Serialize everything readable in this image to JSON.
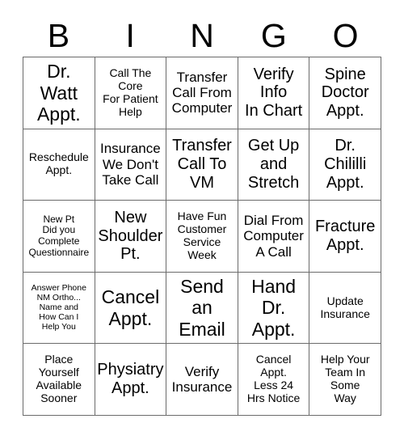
{
  "card": {
    "header_letters": [
      "B",
      "I",
      "N",
      "G",
      "O"
    ],
    "accent_color": "#000000",
    "border_color": "#6b6b6b",
    "cell_background": "#ffffff"
  },
  "grid": {
    "columns": 5,
    "rows": 5,
    "cells": [
      {
        "text": "Dr.\nWatt\nAppt.",
        "size": "fs-xl"
      },
      {
        "text": "Call The\nCore\nFor Patient\nHelp",
        "size": "fs-sm"
      },
      {
        "text": "Transfer\nCall From\nComputer",
        "size": "fs-md"
      },
      {
        "text": "Verify\nInfo\nIn Chart",
        "size": "fs-lg"
      },
      {
        "text": "Spine\nDoctor\nAppt.",
        "size": "fs-lg"
      },
      {
        "text": "Reschedule\nAppt.",
        "size": "fs-sm"
      },
      {
        "text": "Insurance\nWe Don't\nTake Call",
        "size": "fs-md"
      },
      {
        "text": "Transfer\nCall To\nVM",
        "size": "fs-lg"
      },
      {
        "text": "Get Up\nand\nStretch",
        "size": "fs-lg"
      },
      {
        "text": "Dr.\nChililli\nAppt.",
        "size": "fs-lg"
      },
      {
        "text": "New Pt\nDid you\nComplete\nQuestionnaire",
        "size": "fs-xs"
      },
      {
        "text": "New\nShoulder\nPt.",
        "size": "fs-lg"
      },
      {
        "text": "Have Fun\nCustomer\nService\nWeek",
        "size": "fs-sm"
      },
      {
        "text": "Dial From\nComputer\nA Call",
        "size": "fs-md"
      },
      {
        "text": "Fracture\nAppt.",
        "size": "fs-lg"
      },
      {
        "text": "Answer Phone\nNM Ortho...\nName and\nHow Can I\nHelp You",
        "size": "fs-xxs"
      },
      {
        "text": "Cancel\nAppt.",
        "size": "fs-xl"
      },
      {
        "text": "Send\nan\nEmail",
        "size": "fs-xl"
      },
      {
        "text": "Hand\nDr.\nAppt.",
        "size": "fs-xl"
      },
      {
        "text": "Update\nInsurance",
        "size": "fs-sm"
      },
      {
        "text": "Place\nYourself\nAvailable\nSooner",
        "size": "fs-sm"
      },
      {
        "text": "Physiatry\nAppt.",
        "size": "fs-lg"
      },
      {
        "text": "Verify\nInsurance",
        "size": "fs-md"
      },
      {
        "text": "Cancel\nAppt.\nLess 24\nHrs Notice",
        "size": "fs-sm"
      },
      {
        "text": "Help Your\nTeam In\nSome\nWay",
        "size": "fs-sm"
      }
    ]
  }
}
